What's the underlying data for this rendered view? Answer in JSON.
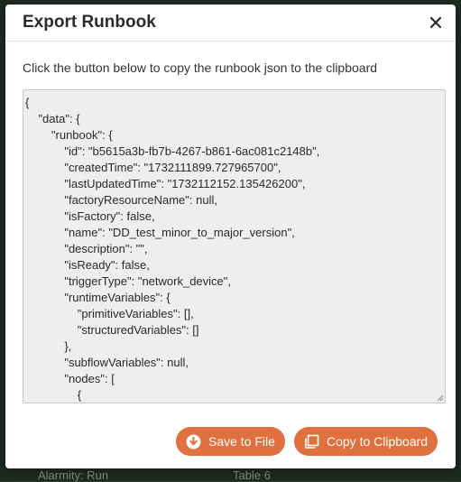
{
  "colors": {
    "accent": "#e0713e",
    "json_background": "#eeeeee"
  },
  "background": {
    "left_text": "Alarmity: Run",
    "right_text": "Table 6"
  },
  "modal": {
    "title": "Export Runbook",
    "close_icon": "close-icon",
    "instruction": "Click the button below to copy the runbook json to the clipboard",
    "json_lines": [
      "{",
      "    \"data\": {",
      "        \"runbook\": {",
      "            \"id\": \"b5615a3b-fb7b-4267-b861-6ac081c2148b\",",
      "            \"createdTime\": \"1732111899.727965700\",",
      "            \"lastUpdatedTime\": \"1732112152.135426200\",",
      "            \"factoryResourceName\": null,",
      "            \"isFactory\": false,",
      "            \"name\": \"DD_test_minor_to_major_version\",",
      "            \"description\": \"\",",
      "            \"isReady\": false,",
      "            \"triggerType\": \"network_device\",",
      "            \"runtimeVariables\": {",
      "                \"primitiveVariables\": [],",
      "                \"structuredVariables\": []",
      "            },",
      "            \"subflowVariables\": null,",
      "            \"nodes\": [",
      "                {"
    ],
    "buttons": {
      "save_label": "Save to File",
      "save_icon": "download-circle-icon",
      "copy_label": "Copy to Clipboard",
      "copy_icon": "copy-icon"
    }
  }
}
